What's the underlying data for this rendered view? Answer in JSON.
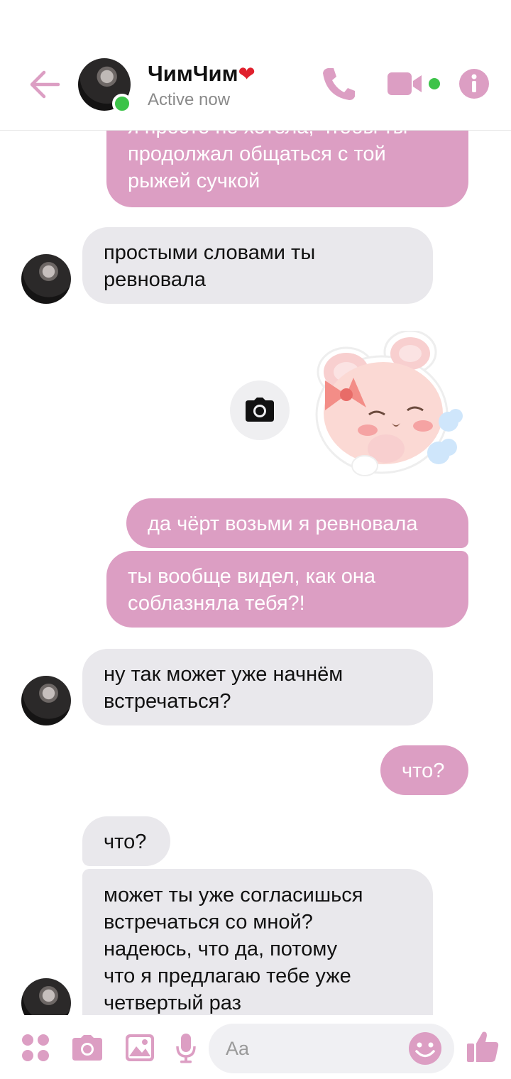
{
  "header": {
    "contact_name": "ЧимЧим",
    "heart": "❤",
    "status": "Active now"
  },
  "messages": [
    {
      "side": "out",
      "lines": [
        "я просто не хотела, чтобы ты",
        "продолжал общаться с той",
        "рыжей сучкой"
      ]
    },
    {
      "side": "in",
      "lines": [
        "простыми словами ты",
        "ревновала"
      ]
    },
    {
      "side": "out",
      "type": "sticker",
      "sticker": "pink-bear-bow-sticker"
    },
    {
      "side": "out",
      "lines": [
        "да чёрт возьми я ревновала"
      ]
    },
    {
      "side": "out",
      "lines": [
        "ты вообще видел, как она",
        "соблазняла тебя?!"
      ]
    },
    {
      "side": "in",
      "lines": [
        "ну так может уже начнём",
        "встречаться?"
      ]
    },
    {
      "side": "out",
      "lines": [
        "что?"
      ]
    },
    {
      "side": "in",
      "lines": [
        "что?"
      ]
    },
    {
      "side": "in",
      "lines": [
        "может ты уже согласишься",
        "встречаться со мной?",
        "надеюсь, что да, потому",
        "что я предлагаю тебе уже",
        "четвертый раз"
      ]
    }
  ],
  "composer": {
    "placeholder": "Aa"
  },
  "colors": {
    "accent": "#dc9ec3",
    "incoming_bubble": "#e9e8ec",
    "online": "#3cc349"
  }
}
